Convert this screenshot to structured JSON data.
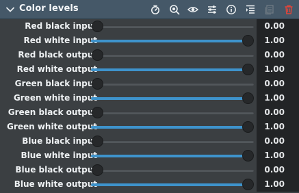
{
  "header": {
    "title": "Color levels",
    "icons": [
      "timer-icon",
      "zoom-icon",
      "eye-icon",
      "sliders-icon",
      "info-icon",
      "list-icon",
      "copy-icon",
      "trash-icon"
    ],
    "accent_color": "#3e93cc",
    "trash_color": "#e0453a"
  },
  "rows": [
    {
      "label": "Red black input",
      "value": "0.00",
      "fraction": 0.0
    },
    {
      "label": "Red white input",
      "value": "1.00",
      "fraction": 1.0
    },
    {
      "label": "Red black output",
      "value": "0.00",
      "fraction": 0.0
    },
    {
      "label": "Red white output",
      "value": "1.00",
      "fraction": 1.0
    },
    {
      "label": "Green black input",
      "value": "0.00",
      "fraction": 0.0
    },
    {
      "label": "Green white input",
      "value": "1.00",
      "fraction": 1.0
    },
    {
      "label": "Green black output",
      "value": "0.00",
      "fraction": 0.0
    },
    {
      "label": "Green white output",
      "value": "1.00",
      "fraction": 1.0
    },
    {
      "label": "Blue black input",
      "value": "0.00",
      "fraction": 0.0
    },
    {
      "label": "Blue white input",
      "value": "1.00",
      "fraction": 1.0
    },
    {
      "label": "Blue black output",
      "value": "0.00",
      "fraction": 0.0
    },
    {
      "label": "Blue white output",
      "value": "1.00",
      "fraction": 1.0
    }
  ]
}
